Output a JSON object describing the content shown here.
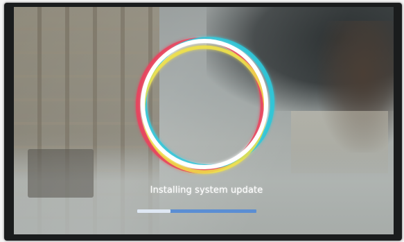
{
  "screen": {
    "status_text": "Installing system update",
    "progress": 0.28,
    "progress_track_color": "#5b8ed3",
    "progress_fill_color": "#dfe8f4",
    "boot_animation": "android-colored-ring-icon"
  },
  "colors": {
    "ring_red": "#e8425e",
    "ring_cyan": "#30c6d8",
    "ring_yellow": "#f0e24a",
    "ring_white": "#ffffff"
  }
}
